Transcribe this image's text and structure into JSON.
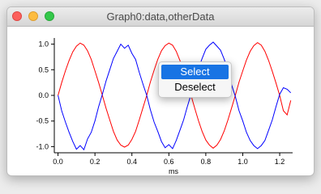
{
  "window": {
    "title": "Graph0:data,otherData"
  },
  "menu": {
    "items": [
      "Select",
      "Deselect"
    ]
  },
  "chart_data": {
    "type": "line",
    "xlabel": "ms",
    "ylabel": "",
    "xlim": [
      -0.02,
      1.27
    ],
    "ylim": [
      -1.12,
      1.12
    ],
    "xticks": [
      0.0,
      0.2,
      0.4,
      0.6,
      0.8,
      1.0,
      1.2
    ],
    "xtick_labels": [
      "0.0",
      "0.2",
      "0.4",
      "0.6",
      "0.8",
      "1.0",
      "1.2"
    ],
    "yticks": [
      1.0,
      0.5,
      0.0,
      -0.5,
      -1.0
    ],
    "ytick_labels": [
      "1.0",
      "0.5",
      "0.0",
      "-0.5",
      "-1.0"
    ],
    "series": [
      {
        "color": "#ff0000",
        "x": [
          0.0,
          0.02,
          0.04,
          0.06,
          0.08,
          0.1,
          0.12,
          0.14,
          0.16,
          0.18,
          0.2,
          0.22,
          0.24,
          0.26,
          0.28,
          0.3,
          0.32,
          0.34,
          0.36,
          0.38,
          0.4,
          0.42,
          0.44,
          0.46,
          0.48,
          0.5,
          0.52,
          0.54,
          0.56,
          0.58,
          0.6,
          0.62,
          0.64,
          0.66,
          0.68,
          0.7,
          0.72,
          0.74,
          0.76,
          0.78,
          0.8,
          0.82,
          0.84,
          0.86,
          0.88,
          0.9,
          0.92,
          0.94,
          0.96,
          0.98,
          1.0,
          1.02,
          1.04,
          1.06,
          1.08,
          1.1,
          1.12,
          1.14,
          1.16,
          1.18,
          1.2,
          1.22,
          1.24,
          1.26
        ],
        "values": [
          0.0,
          0.25,
          0.48,
          0.68,
          0.85,
          0.96,
          1.02,
          0.98,
          0.87,
          0.7,
          0.48,
          0.25,
          0.0,
          -0.25,
          -0.48,
          -0.7,
          -0.87,
          -0.97,
          -1.01,
          -0.97,
          -0.86,
          -0.7,
          -0.48,
          -0.24,
          0.0,
          0.26,
          0.49,
          0.7,
          0.87,
          0.97,
          1.02,
          0.98,
          0.86,
          0.68,
          0.47,
          0.23,
          0.0,
          -0.25,
          -0.49,
          -0.7,
          -0.87,
          -0.97,
          -1.03,
          -0.97,
          -0.86,
          -0.69,
          -0.48,
          -0.24,
          0.0,
          0.26,
          0.48,
          0.69,
          0.86,
          0.97,
          1.03,
          0.98,
          0.86,
          0.68,
          0.47,
          0.24,
          0.0,
          -0.3,
          -0.38,
          -0.1
        ]
      },
      {
        "color": "#0000ff",
        "x": [
          0.0,
          0.02,
          0.04,
          0.06,
          0.08,
          0.1,
          0.12,
          0.14,
          0.16,
          0.18,
          0.2,
          0.22,
          0.24,
          0.26,
          0.28,
          0.3,
          0.32,
          0.34,
          0.36,
          0.38,
          0.4,
          0.42,
          0.44,
          0.46,
          0.48,
          0.5,
          0.52,
          0.54,
          0.56,
          0.58,
          0.6,
          0.62,
          0.64,
          0.66,
          0.68,
          0.7,
          0.72,
          0.74,
          0.76,
          0.78,
          0.8,
          0.82,
          0.84,
          0.86,
          0.88,
          0.9,
          0.92,
          0.94,
          0.96,
          0.98,
          1.0,
          1.02,
          1.04,
          1.06,
          1.08,
          1.1,
          1.12,
          1.14,
          1.16,
          1.18,
          1.2,
          1.22,
          1.24,
          1.26
        ],
        "values": [
          0.0,
          -0.3,
          -0.52,
          -0.72,
          -0.9,
          -1.05,
          -0.98,
          -1.06,
          -0.85,
          -0.72,
          -0.5,
          -0.22,
          0.02,
          0.28,
          0.5,
          0.72,
          0.86,
          1.0,
          0.92,
          0.98,
          0.82,
          0.7,
          0.45,
          0.22,
          0.0,
          -0.28,
          -0.52,
          -0.7,
          -0.9,
          -1.02,
          -0.96,
          -1.04,
          -0.88,
          -0.68,
          -0.48,
          -0.22,
          0.02,
          0.27,
          0.52,
          0.72,
          0.9,
          0.98,
          1.04,
          0.96,
          0.88,
          0.7,
          0.48,
          0.2,
          -0.02,
          -0.3,
          -0.5,
          -0.72,
          -0.88,
          -0.98,
          -1.04,
          -0.98,
          -0.88,
          -0.68,
          -0.48,
          -0.22,
          0.02,
          0.15,
          0.12,
          0.05
        ]
      }
    ]
  }
}
